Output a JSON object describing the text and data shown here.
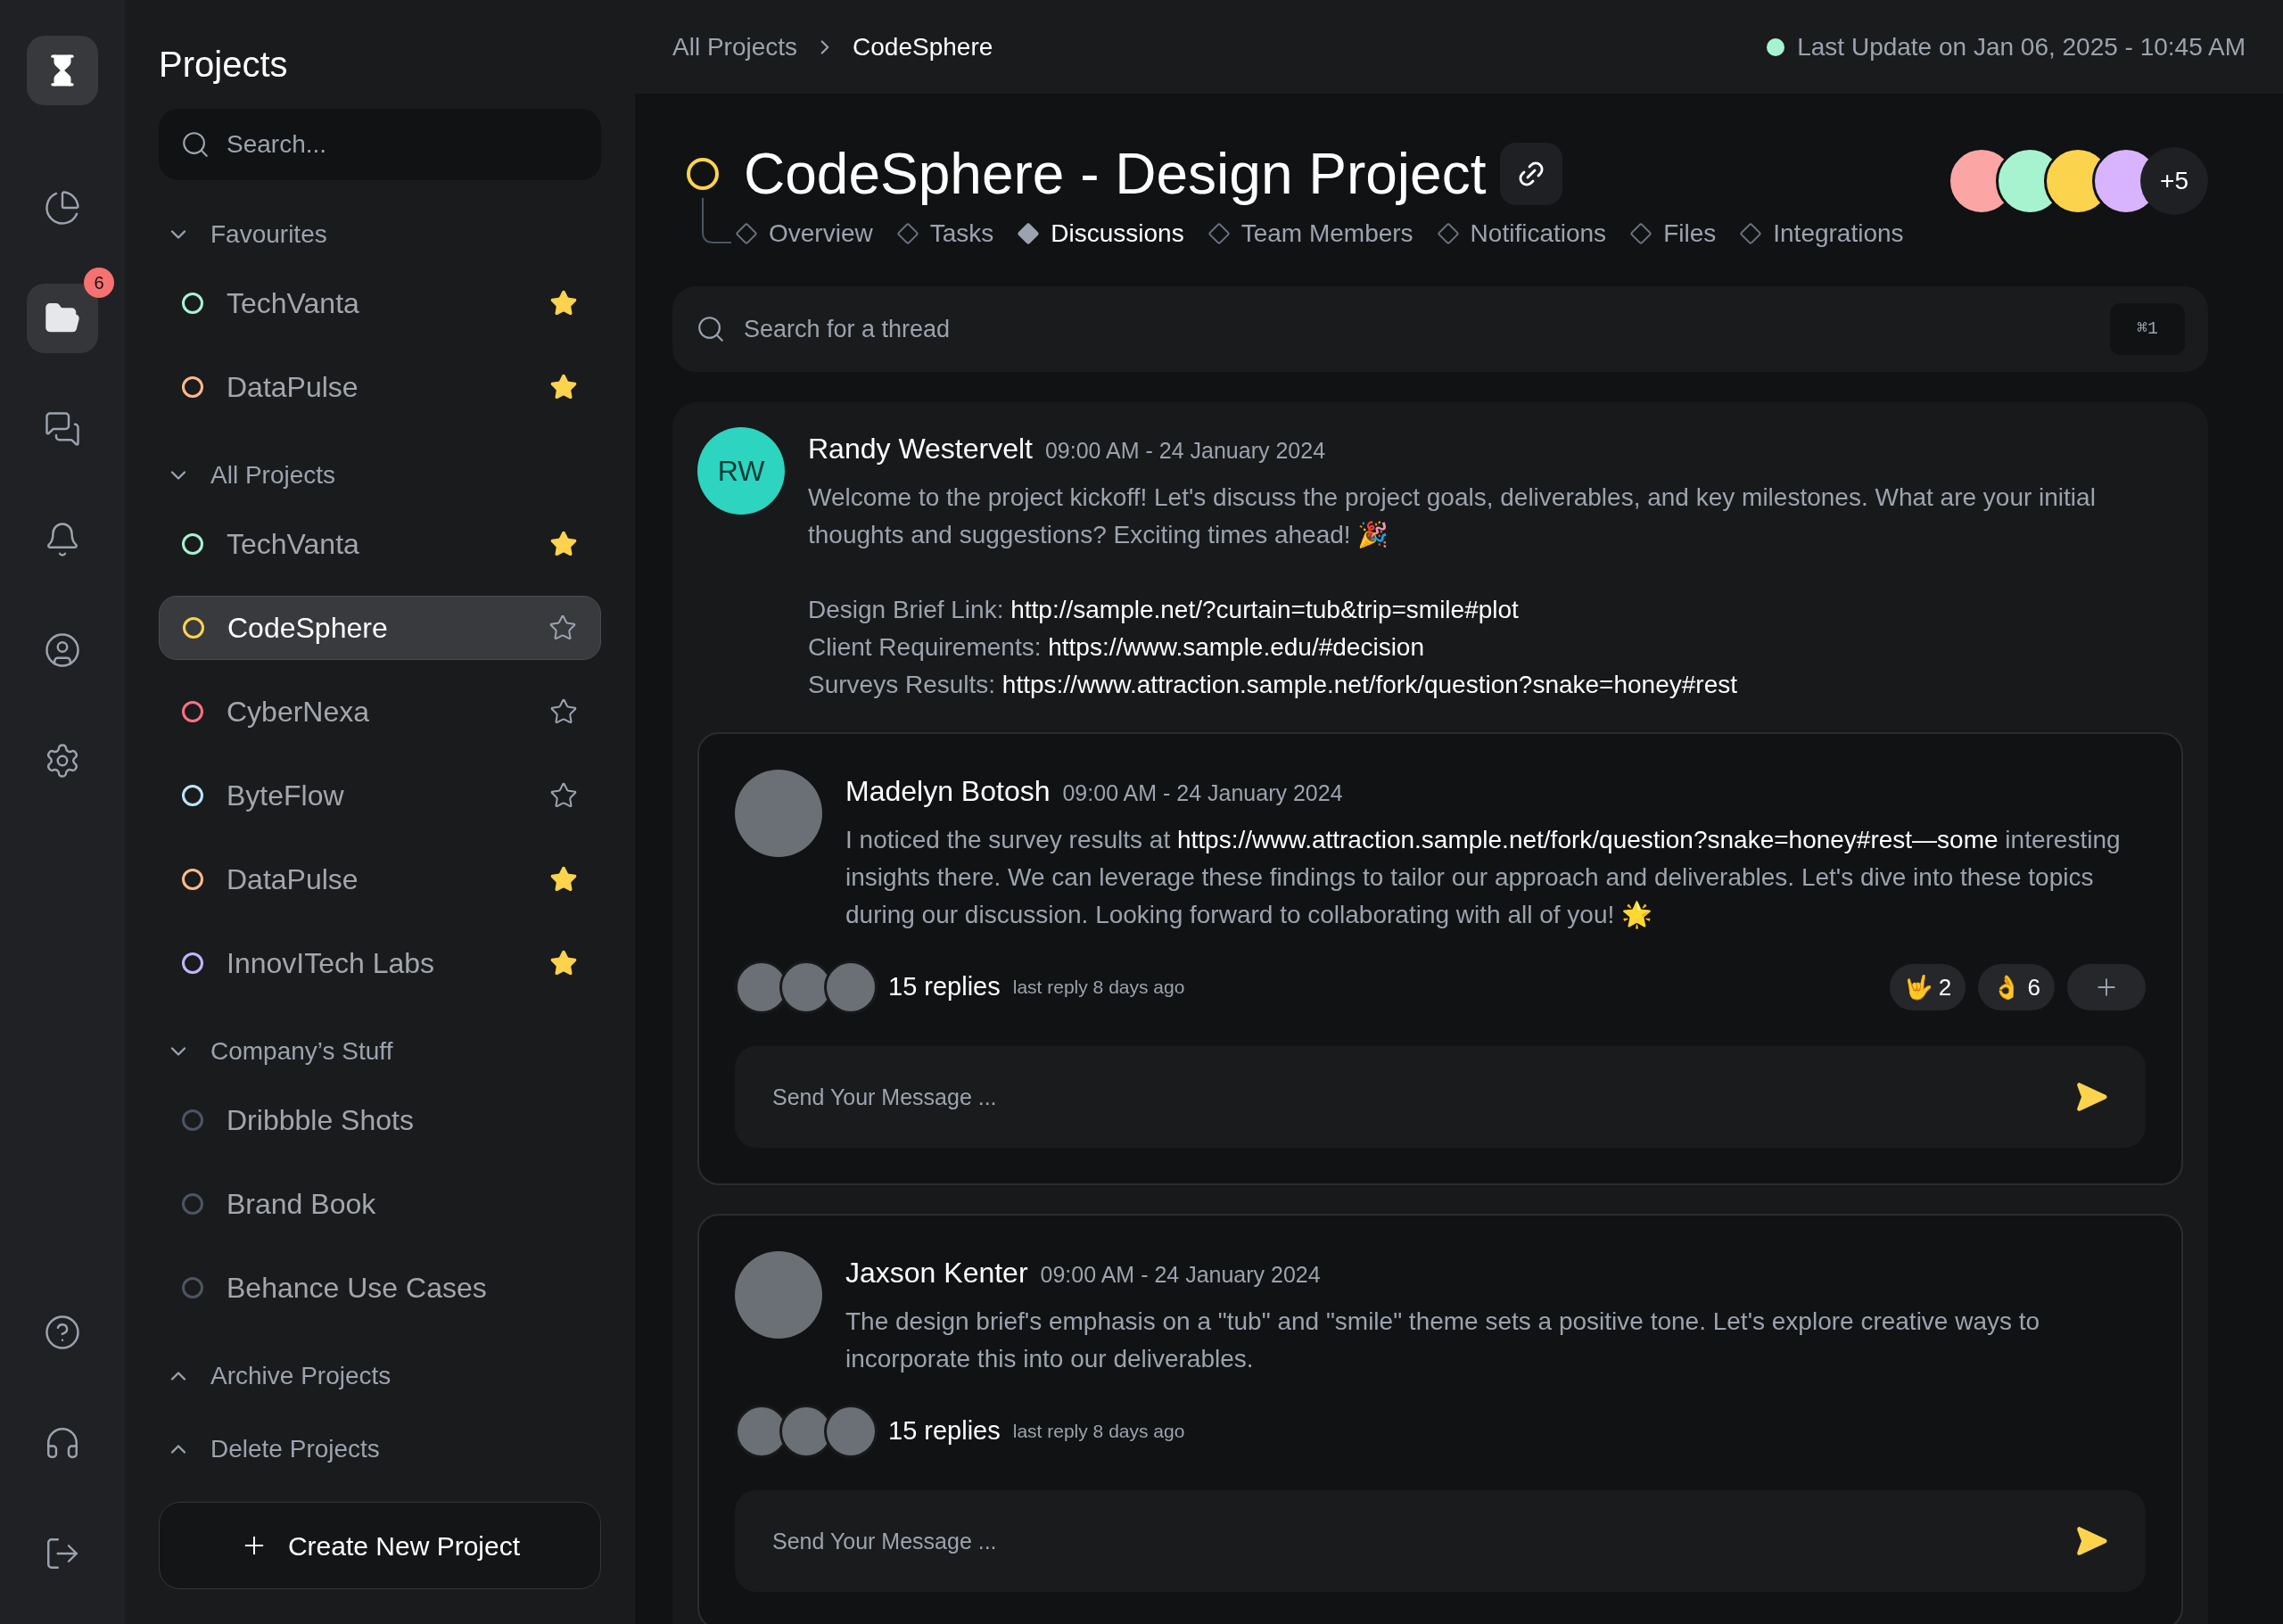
{
  "rail": {
    "items": [
      {
        "kind": "chart",
        "selected": false
      },
      {
        "kind": "folder",
        "selected": true,
        "badge": "6"
      },
      {
        "kind": "chat",
        "selected": false
      },
      {
        "kind": "bell",
        "selected": false
      },
      {
        "kind": "user",
        "selected": false
      },
      {
        "kind": "settings",
        "selected": false
      }
    ],
    "bottom_items": [
      {
        "kind": "help",
        "selected": false
      },
      {
        "kind": "headset",
        "selected": false
      },
      {
        "kind": "logout",
        "selected": false
      }
    ]
  },
  "sidebar": {
    "title": "Projects",
    "search": {
      "placeholder": "Search..."
    },
    "sections": [
      {
        "label": "Favourites",
        "expanded": true,
        "items": [
          {
            "label": "TechVanta",
            "color": "#a7f3d0",
            "starred": true,
            "selected": false
          },
          {
            "label": "DataPulse",
            "color": "#fdba8c",
            "starred": true,
            "selected": false
          }
        ]
      },
      {
        "label": "All Projects",
        "expanded": true,
        "items": [
          {
            "label": "TechVanta",
            "color": "#a7f3d0",
            "starred": true,
            "selected": false
          },
          {
            "label": "CodeSphere",
            "color": "#fcd34d",
            "starred": false,
            "selected": true
          },
          {
            "label": "CyberNexa",
            "color": "#fb7185",
            "starred": false,
            "selected": false
          },
          {
            "label": "ByteFlow",
            "color": "#bae6fd",
            "starred": false,
            "selected": false
          },
          {
            "label": "DataPulse",
            "color": "#fdba8c",
            "starred": true,
            "selected": false
          },
          {
            "label": "InnovITech Labs",
            "color": "#c4b5fd",
            "starred": true,
            "selected": false
          }
        ]
      },
      {
        "label": "Company’s Stuff",
        "expanded": true,
        "items": [
          {
            "label": "Dribbble Shots",
            "color": "#4b5563",
            "selected": false
          },
          {
            "label": "Brand Book",
            "color": "#4b5563",
            "selected": false
          },
          {
            "label": "Behance Use Cases",
            "color": "#4b5563",
            "selected": false
          }
        ]
      },
      {
        "label": "Archive Projects",
        "expanded": false
      },
      {
        "label": "Delete Projects",
        "expanded": false
      }
    ],
    "create_button": "Create New Project"
  },
  "breadcrumb": [
    "All Projects",
    "CodeSphere"
  ],
  "last_update": {
    "text": "Last Update on Jan 06, 2025 - 10:45 AM",
    "color": "#a7f3d0"
  },
  "project": {
    "title": "CodeSphere - Design Project",
    "color": "#fcd34d",
    "members_more": "+5"
  },
  "tabs": [
    {
      "label": "Overview",
      "selected": false
    },
    {
      "label": "Tasks",
      "selected": false
    },
    {
      "label": "Discussions",
      "selected": true
    },
    {
      "label": "Team Members",
      "selected": false
    },
    {
      "label": "Notifications",
      "selected": false
    },
    {
      "label": "Files",
      "selected": false
    },
    {
      "label": "Integrations",
      "selected": false
    }
  ],
  "thread_search": {
    "placeholder": "Search for a thread",
    "shortcut": "⌘1"
  },
  "thread": {
    "initials": "RW",
    "name": "Randy Westervelt",
    "time": "09:00 AM - 24 January 2024",
    "body": [
      {
        "kind": "text",
        "text": "Welcome to the project kickoff! Let's discuss the project goals, deliverables, and key milestones. What are your initial thoughts and suggestions? Exciting times ahead! 🎉"
      }
    ],
    "links": [
      {
        "label": "Design Brief Link:",
        "url": "http://sample.net/?curtain=tub&trip=smile#plot"
      },
      {
        "label": "Client Requirements:",
        "url": "https://www.sample.edu/#decision"
      },
      {
        "label": "Surveys Results:",
        "url": "https://www.attraction.sample.net/fork/question?snake=honey#rest"
      }
    ],
    "replies": [
      {
        "name": "Madelyn Botosh",
        "time": "09:00 AM - 24 January 2024",
        "body": [
          {
            "kind": "text",
            "text": "I noticed the survey results at "
          },
          {
            "kind": "link",
            "text": "https://www.attraction.sample.net/fork/question?snake=honey#rest—some"
          },
          {
            "kind": "text",
            "text": " interesting insights there. We can leverage these findings to tailor our approach and deliverables. Let's dive into these topics during our discussion. Looking forward to collaborating with all of you! 🌟"
          }
        ],
        "reply_count": "15 replies",
        "last_reply": "last reply 8 days ago",
        "reactions": [
          {
            "emoji": "🤟",
            "count": "2"
          },
          {
            "emoji": "👌",
            "count": "6"
          }
        ],
        "composer_placeholder": "Send Your Message ..."
      },
      {
        "name": "Jaxson Kenter",
        "time": "09:00 AM - 24 January 2024",
        "body": [
          {
            "kind": "text",
            "text": "The design brief's emphasis on a \"tub\" and \"smile\" theme sets a positive tone. Let's explore creative ways to incorporate this into our deliverables."
          }
        ],
        "reply_count": "15 replies",
        "last_reply": "last reply 8 days ago",
        "composer_placeholder": "Send Your Message ..."
      }
    ]
  }
}
